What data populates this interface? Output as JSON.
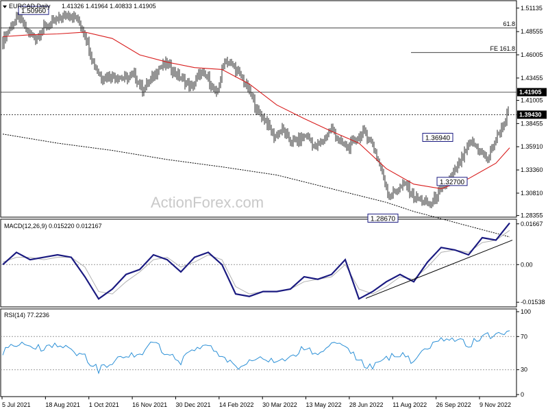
{
  "header": {
    "symbol_label": "EURCAD,Daily",
    "ohlc": "1.41326 1.41964 1.40833 1.41905"
  },
  "watermark": "ActionForex.com",
  "colors": {
    "price_bars": "#2b2b2b",
    "ma_short": "#d81b1b",
    "ma_long": "#000000",
    "macd_line": "#1a1a80",
    "macd_signal": "#b0b0b0",
    "rsi_line": "#2a8fd6",
    "tag_bg": "#000000",
    "annotation_border": "#1a1a80"
  },
  "chart_data": [
    {
      "type": "line",
      "panel": "price",
      "title": "EURCAD,Daily",
      "x_ticks": [
        "5 Jul 2021",
        "18 Aug 2021",
        "1 Oct 2021",
        "16 Nov 2021",
        "30 Dec 2021",
        "14 Feb 2022",
        "30 Mar 2022",
        "13 May 2022",
        "28 Jun 2022",
        "11 Aug 2022",
        "26 Sep 2022",
        "9 Nov 2022"
      ],
      "y_ticks": [
        "1.51135",
        "1.48555",
        "1.46005",
        "1.43455",
        "1.41005",
        "1.38455",
        "1.35910",
        "1.33360",
        "1.30810",
        "1.28355"
      ],
      "ylim": [
        1.2825,
        1.518
      ],
      "series": [
        {
          "kind": "price",
          "x": [
            0,
            6,
            12,
            18,
            24,
            30,
            36,
            42,
            48,
            54,
            60,
            66,
            72,
            78,
            84,
            90,
            96,
            102,
            108,
            114,
            120,
            126,
            132,
            138,
            144,
            150,
            156,
            162,
            168,
            174,
            180,
            186,
            192,
            198,
            204,
            210,
            216,
            222,
            228,
            234,
            240,
            246,
            252,
            258,
            264,
            270,
            276,
            282,
            288,
            294,
            300,
            306,
            312,
            318,
            324,
            330,
            336,
            342,
            348,
            354,
            360,
            366,
            370
          ],
          "values": [
            1.475,
            1.492,
            1.502,
            1.485,
            1.478,
            1.49,
            1.495,
            1.5,
            1.505,
            1.5,
            1.483,
            1.452,
            1.435,
            1.437,
            1.436,
            1.434,
            1.438,
            1.422,
            1.432,
            1.446,
            1.45,
            1.44,
            1.432,
            1.424,
            1.44,
            1.434,
            1.415,
            1.455,
            1.448,
            1.436,
            1.42,
            1.398,
            1.388,
            1.37,
            1.378,
            1.365,
            1.366,
            1.372,
            1.358,
            1.366,
            1.38,
            1.364,
            1.358,
            1.368,
            1.375,
            1.362,
            1.335,
            1.305,
            1.312,
            1.318,
            1.304,
            1.3,
            1.295,
            1.308,
            1.318,
            1.332,
            1.348,
            1.365,
            1.355,
            1.345,
            1.368,
            1.385,
            1.402
          ]
        },
        {
          "kind": "ma_short",
          "x": [
            0,
            20,
            40,
            60,
            80,
            100,
            120,
            140,
            160,
            180,
            200,
            220,
            240,
            260,
            280,
            300,
            320,
            340,
            360,
            370
          ],
          "values": [
            1.48,
            1.482,
            1.483,
            1.485,
            1.478,
            1.46,
            1.452,
            1.446,
            1.444,
            1.428,
            1.405,
            1.39,
            1.376,
            1.363,
            1.335,
            1.318,
            1.313,
            1.324,
            1.341,
            1.358
          ]
        },
        {
          "kind": "ma_long",
          "x": [
            0,
            40,
            80,
            120,
            160,
            200,
            240,
            280,
            300,
            320,
            340,
            360,
            370
          ],
          "values": [
            1.373,
            1.363,
            1.355,
            1.345,
            1.337,
            1.328,
            1.313,
            1.298,
            1.288,
            1.28,
            1.272,
            1.264,
            1.26
          ]
        }
      ],
      "horizontal_lines": [
        {
          "value": 1.4895,
          "label": "61.8",
          "style": "solid",
          "extent": "full"
        },
        {
          "value": 1.4625,
          "label": "FE 161.8",
          "style": "solid",
          "extent": "partial"
        },
        {
          "value": 1.41905,
          "label": "",
          "style": "solid-thin",
          "extent": "full"
        },
        {
          "value": 1.3943,
          "label": "",
          "style": "dotted",
          "extent": "full"
        }
      ],
      "annotations": [
        {
          "label": "1.50960",
          "value": 1.5096,
          "x": 23
        },
        {
          "label": "1.36940",
          "value": 1.3694,
          "x": 329
        },
        {
          "label": "1.32700",
          "value": 1.327,
          "x": 341
        },
        {
          "label": "1.28670",
          "value": 1.2867,
          "x": 289
        }
      ],
      "price_tags": [
        {
          "label": "1.41905",
          "value": 1.41905
        },
        {
          "label": "1.39430",
          "value": 1.3943
        }
      ]
    },
    {
      "type": "line",
      "panel": "macd",
      "title": "MACD(12,26,9) 0.015220 0.012167",
      "y_ticks": [
        "0.01667",
        "0.00",
        "-0.01538"
      ],
      "ylim": [
        -0.017,
        0.018
      ],
      "series": [
        {
          "kind": "macd",
          "x": [
            0,
            10,
            20,
            30,
            40,
            50,
            60,
            70,
            80,
            90,
            100,
            110,
            120,
            130,
            140,
            150,
            160,
            170,
            180,
            190,
            200,
            210,
            220,
            230,
            240,
            250,
            260,
            270,
            280,
            290,
            300,
            310,
            320,
            330,
            340,
            350,
            360,
            370
          ],
          "values": [
            0.0,
            0.005,
            0.002,
            0.003,
            0.004,
            0.003,
            -0.005,
            -0.014,
            -0.01,
            -0.004,
            -0.002,
            0.004,
            0.002,
            -0.003,
            0.003,
            0.005,
            0.0,
            -0.012,
            -0.013,
            -0.011,
            -0.011,
            -0.01,
            -0.005,
            -0.006,
            -0.004,
            0.002,
            -0.014,
            -0.011,
            -0.007,
            -0.004,
            -0.007,
            0.001,
            0.007,
            0.006,
            0.004,
            0.011,
            0.01,
            0.017
          ]
        },
        {
          "kind": "signal",
          "x": [
            0,
            10,
            20,
            30,
            40,
            50,
            60,
            70,
            80,
            90,
            100,
            110,
            120,
            130,
            140,
            150,
            160,
            170,
            180,
            190,
            200,
            210,
            220,
            230,
            240,
            250,
            260,
            270,
            280,
            290,
            300,
            310,
            320,
            330,
            340,
            350,
            360,
            370
          ],
          "values": [
            0.001,
            0.003,
            0.003,
            0.002,
            0.003,
            0.003,
            -0.001,
            -0.011,
            -0.012,
            -0.007,
            -0.003,
            0.002,
            0.003,
            -0.001,
            0.001,
            0.004,
            0.002,
            -0.009,
            -0.012,
            -0.011,
            -0.011,
            -0.01,
            -0.007,
            -0.006,
            -0.005,
            0.0,
            -0.01,
            -0.012,
            -0.009,
            -0.005,
            -0.006,
            -0.001,
            0.005,
            0.006,
            0.005,
            0.009,
            0.01,
            0.014
          ]
        }
      ],
      "trendline": {
        "x": [
          265,
          372
        ],
        "values": [
          -0.0138,
          0.01
        ]
      }
    },
    {
      "type": "line",
      "panel": "rsi",
      "title": "RSI(14) 77.2236",
      "y_ticks": [
        "100",
        "70",
        "30",
        "0"
      ],
      "ylim": [
        0,
        100
      ],
      "levels": [
        70,
        30
      ],
      "series": [
        {
          "kind": "rsi",
          "x": [
            0,
            10,
            20,
            30,
            40,
            50,
            60,
            70,
            80,
            90,
            100,
            110,
            120,
            130,
            140,
            150,
            160,
            170,
            180,
            190,
            200,
            210,
            220,
            230,
            240,
            250,
            260,
            270,
            280,
            290,
            300,
            310,
            320,
            330,
            340,
            350,
            360,
            370
          ],
          "values": [
            52,
            60,
            58,
            55,
            60,
            55,
            45,
            30,
            38,
            48,
            50,
            62,
            50,
            40,
            55,
            60,
            45,
            32,
            40,
            45,
            42,
            47,
            55,
            50,
            58,
            62,
            40,
            32,
            45,
            48,
            40,
            55,
            65,
            68,
            60,
            70,
            72,
            77
          ]
        }
      ]
    }
  ]
}
